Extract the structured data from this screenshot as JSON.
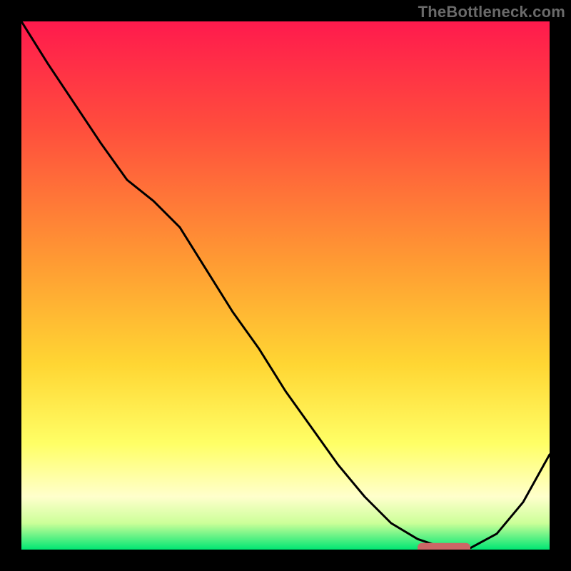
{
  "watermark": "TheBottleneck.com",
  "chart_data": {
    "type": "line",
    "title": "",
    "xlabel": "",
    "ylabel": "",
    "x": [
      0.0,
      0.05,
      0.1,
      0.15,
      0.2,
      0.25,
      0.3,
      0.35,
      0.4,
      0.45,
      0.5,
      0.55,
      0.6,
      0.65,
      0.7,
      0.75,
      0.8,
      0.825,
      0.85,
      0.9,
      0.95,
      1.0
    ],
    "values": [
      1.0,
      0.92,
      0.845,
      0.77,
      0.7,
      0.66,
      0.61,
      0.53,
      0.45,
      0.38,
      0.3,
      0.23,
      0.16,
      0.1,
      0.05,
      0.02,
      0.003,
      0.003,
      0.003,
      0.03,
      0.09,
      0.18
    ],
    "xlim": [
      0,
      1
    ],
    "ylim": [
      0,
      1
    ],
    "marker": {
      "shape": "rounded-bar",
      "x0": 0.75,
      "x1": 0.85,
      "y": 0.003,
      "color": "#cc6666"
    },
    "background_gradient": {
      "stops": [
        {
          "offset": 0.0,
          "color": "#ff1a4d"
        },
        {
          "offset": 0.2,
          "color": "#ff4d3d"
        },
        {
          "offset": 0.45,
          "color": "#ff9933"
        },
        {
          "offset": 0.65,
          "color": "#ffd633"
        },
        {
          "offset": 0.8,
          "color": "#ffff66"
        },
        {
          "offset": 0.9,
          "color": "#ffffcc"
        },
        {
          "offset": 0.95,
          "color": "#ccff99"
        },
        {
          "offset": 1.0,
          "color": "#00e673"
        }
      ]
    }
  }
}
